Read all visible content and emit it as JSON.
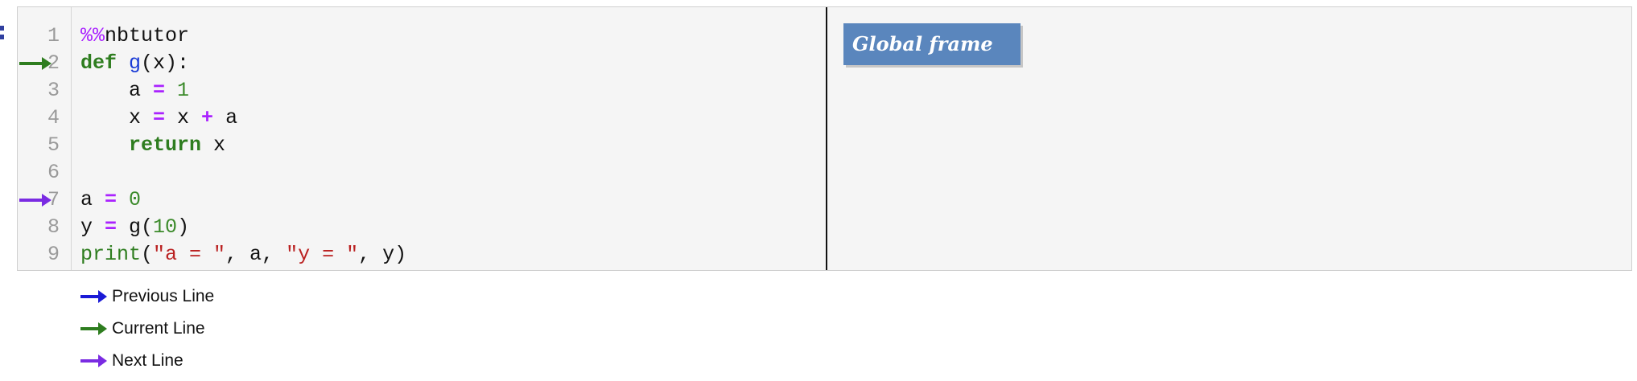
{
  "code_lines": [
    {
      "num": "1",
      "tokens": [
        {
          "t": "%%",
          "c": "magic"
        },
        {
          "t": "nbtutor",
          "c": ""
        }
      ]
    },
    {
      "num": "2",
      "tokens": [
        {
          "t": "def",
          "c": "kw"
        },
        {
          "t": " ",
          "c": ""
        },
        {
          "t": "g",
          "c": "fn"
        },
        {
          "t": "(x):",
          "c": ""
        }
      ],
      "arrow": "current"
    },
    {
      "num": "3",
      "tokens": [
        {
          "t": "    a ",
          "c": ""
        },
        {
          "t": "=",
          "c": "op"
        },
        {
          "t": " ",
          "c": ""
        },
        {
          "t": "1",
          "c": "num"
        }
      ]
    },
    {
      "num": "4",
      "tokens": [
        {
          "t": "    x ",
          "c": ""
        },
        {
          "t": "=",
          "c": "op"
        },
        {
          "t": " x ",
          "c": ""
        },
        {
          "t": "+",
          "c": "op"
        },
        {
          "t": " a",
          "c": ""
        }
      ]
    },
    {
      "num": "5",
      "tokens": [
        {
          "t": "    ",
          "c": ""
        },
        {
          "t": "return",
          "c": "kw"
        },
        {
          "t": " x",
          "c": ""
        }
      ]
    },
    {
      "num": "6",
      "tokens": []
    },
    {
      "num": "7",
      "tokens": [
        {
          "t": "a ",
          "c": ""
        },
        {
          "t": "=",
          "c": "op"
        },
        {
          "t": " ",
          "c": ""
        },
        {
          "t": "0",
          "c": "num"
        }
      ],
      "arrow": "next"
    },
    {
      "num": "8",
      "tokens": [
        {
          "t": "y ",
          "c": ""
        },
        {
          "t": "=",
          "c": "op"
        },
        {
          "t": " g(",
          "c": ""
        },
        {
          "t": "10",
          "c": "num"
        },
        {
          "t": ")",
          "c": ""
        }
      ]
    },
    {
      "num": "9",
      "tokens": [
        {
          "t": "print",
          "c": "builtin"
        },
        {
          "t": "(",
          "c": ""
        },
        {
          "t": "\"a = \"",
          "c": "str"
        },
        {
          "t": ", a, ",
          "c": ""
        },
        {
          "t": "\"y = \"",
          "c": "str"
        },
        {
          "t": ", y)",
          "c": ""
        }
      ]
    }
  ],
  "frames": {
    "global_label": "Global frame"
  },
  "legend": [
    {
      "label": "Previous Line",
      "kind": "previous"
    },
    {
      "label": "Current Line",
      "kind": "current"
    },
    {
      "label": "Next Line",
      "kind": "next"
    }
  ],
  "colors": {
    "previous": "#1a1ad6",
    "current": "#2e7d1f",
    "next": "#7a2be2",
    "frame_bg": "#5a86bd"
  }
}
